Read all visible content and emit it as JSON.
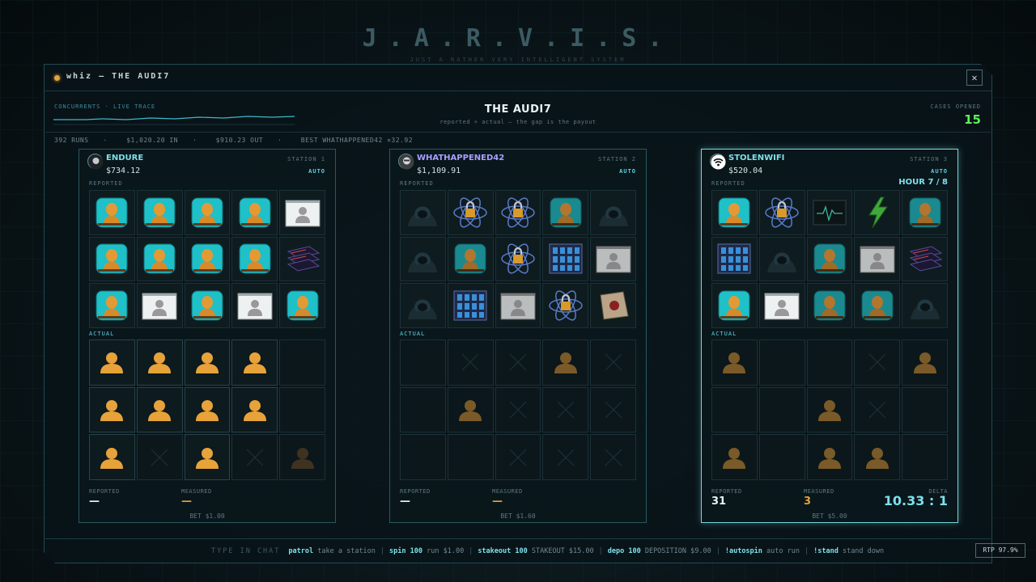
{
  "brand": {
    "title": "J.A.R.V.I.S.",
    "subtitle": "JUST A RATHER VERY INTELLIGENT SYSTEM"
  },
  "window": {
    "title": "whiz — THE AUDI7",
    "close_label": "✕"
  },
  "header": {
    "trace_label": "CONCURRENTS · LIVE TRACE",
    "title": "THE AUDI7",
    "subtitle": "reported ÷ actual — the gap is the payout",
    "cases_label": "CASES OPENED",
    "cases_value": "15"
  },
  "stats": {
    "runs": "392 RUNS",
    "in": "$1,020.20 IN",
    "out": "$910.23 OUT",
    "best": "BEST WHATHAPPENED42 ×32.92"
  },
  "labels": {
    "reported": "REPORTED",
    "actual": "ACTUAL",
    "reported_footer": "REPORTED",
    "measured_footer": "MEASURED",
    "delta": "DELTA"
  },
  "stations": [
    {
      "name": "ENDURE",
      "name_color": "#7de0ea",
      "station": "STATION 1",
      "balance": "$734.12",
      "mode": "AUTO",
      "hour": "",
      "avatar": "endure-avatar",
      "reported": [
        "bust",
        "bust",
        "bust",
        "bust",
        "idcard",
        "bust",
        "bust",
        "bust",
        "bust",
        "server",
        "bust",
        "idcard",
        "bust",
        "idcard",
        "bust"
      ],
      "actual": [
        "person",
        "person",
        "person",
        "person",
        "empty",
        "person",
        "person",
        "person",
        "person",
        "empty",
        "person",
        "x",
        "person",
        "x",
        "dim"
      ],
      "reported_value": "—",
      "measured_value": "—",
      "delta": "",
      "bet": "BET $1.00"
    },
    {
      "name": "WHATHAPPENED42",
      "name_color": "#a9a0ff",
      "station": "STATION 2",
      "balance": "$1,109.91",
      "mode": "AUTO",
      "hour": "",
      "avatar": "whathappened-avatar",
      "reported": [
        "hacker",
        "atom",
        "atom",
        "bustdark",
        "hacker",
        "hacker",
        "bustdark",
        "atom",
        "rack",
        "idcardgray",
        "hacker",
        "rack",
        "idcardgray",
        "atom",
        "folder"
      ],
      "actual": [
        "empty",
        "x",
        "x",
        "persondim",
        "x",
        "empty",
        "persondim",
        "x",
        "x",
        "x",
        "empty",
        "empty",
        "x",
        "x",
        "x"
      ],
      "reported_value": "—",
      "measured_value": "—",
      "delta": "",
      "bet": "BET $1.60"
    },
    {
      "name": "STOLENWIFI",
      "name_color": "#7de0ea",
      "station": "STATION 3",
      "balance": "$520.04",
      "mode": "AUTO",
      "hour": "HOUR 7 / 8",
      "avatar": "wifi-avatar",
      "reported": [
        "bust",
        "atom",
        "monitor",
        "bolt",
        "bustdark",
        "rack",
        "hacker",
        "bustdark",
        "idcardgray",
        "server",
        "bust",
        "idcard",
        "bustdark",
        "bustdark",
        "hacker"
      ],
      "actual": [
        "persondim",
        "empty",
        "empty",
        "x",
        "persondim",
        "empty",
        "empty",
        "persondim",
        "x",
        "empty",
        "persondim",
        "empty",
        "persondim",
        "persondim",
        "empty"
      ],
      "reported_value": "31",
      "measured_value": "3",
      "delta": "10.33 : 1",
      "bet": "BET $5.00"
    }
  ],
  "bottom": {
    "label": "TYPE IN CHAT",
    "commands": [
      {
        "cmd": "patrol",
        "desc": "take a station"
      },
      {
        "cmd": "spin 100",
        "desc": "run $1.00"
      },
      {
        "cmd": "stakeout 100",
        "desc": "STAKEOUT $15.00"
      },
      {
        "cmd": "depo 100",
        "desc": "DEPOSITION $9.00"
      },
      {
        "cmd": "!autospin",
        "desc": "auto run"
      },
      {
        "cmd": "!stand",
        "desc": "stand down"
      }
    ],
    "rtp": "RTP 97.9%"
  },
  "colors": {
    "accent": "#7de0ea",
    "gold": "#e3a23a",
    "green": "#5ef05a",
    "teal_bg": "#1fc0c8"
  }
}
